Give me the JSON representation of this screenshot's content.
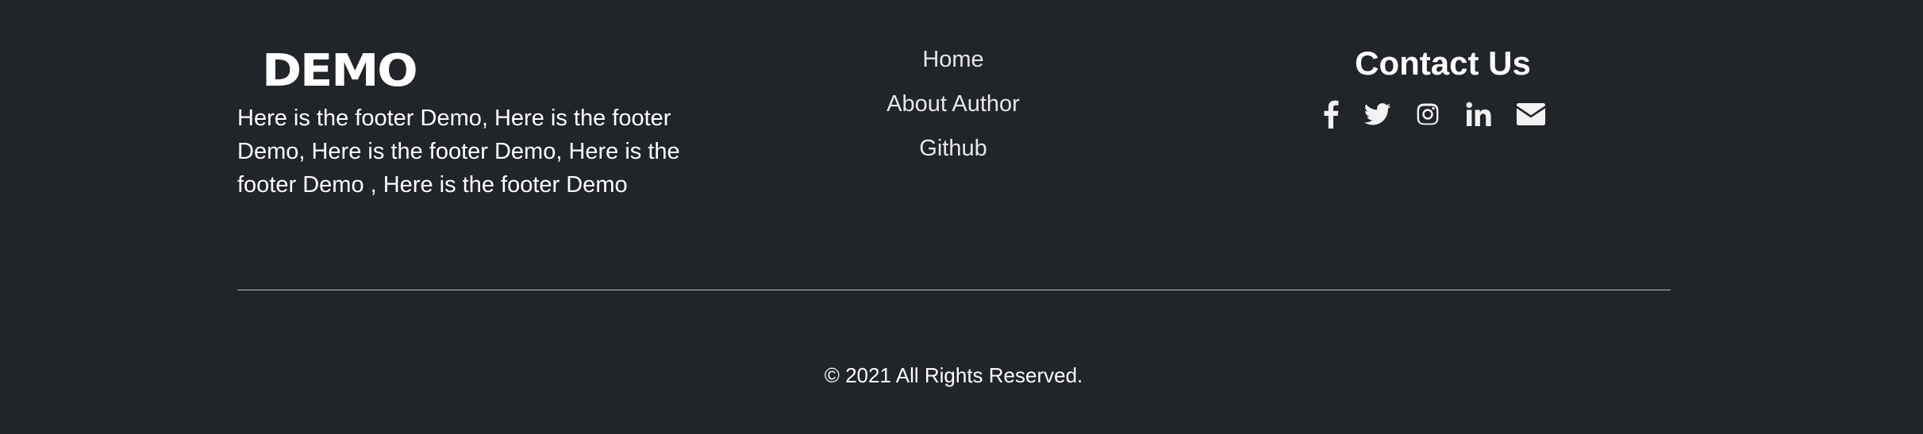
{
  "brand": {
    "logo_text": "DEMO"
  },
  "about": {
    "text": "Here is the footer Demo, Here is the footer Demo, Here is the footer Demo, Here is the footer Demo , Here is the footer Demo"
  },
  "nav": {
    "items": [
      {
        "label": "Home"
      },
      {
        "label": "About Author"
      },
      {
        "label": "Github"
      }
    ]
  },
  "contact": {
    "title": "Contact Us",
    "icons": [
      "facebook-icon",
      "twitter-icon",
      "instagram-icon",
      "linkedin-icon",
      "envelope-icon"
    ]
  },
  "footer": {
    "copyright": "© 2021 All Rights Reserved."
  },
  "colors": {
    "background": "#212428",
    "text": "#ffffff",
    "divider": "#bdbdbd"
  }
}
